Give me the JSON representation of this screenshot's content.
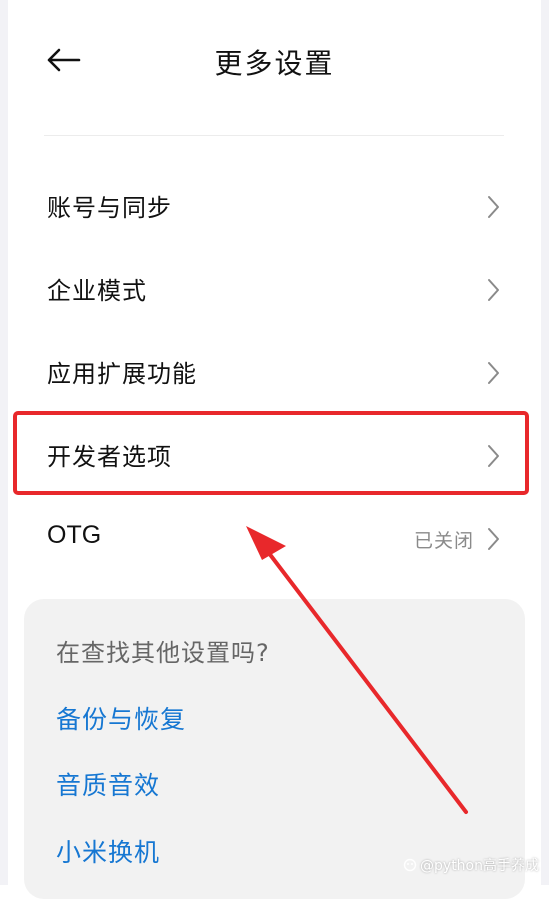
{
  "header": {
    "title": "更多设置",
    "back_icon": "arrow-left-icon"
  },
  "settings": {
    "items": [
      {
        "label": "账号与同步",
        "value": ""
      },
      {
        "label": "企业模式",
        "value": ""
      },
      {
        "label": "应用扩展功能",
        "value": ""
      },
      {
        "label": "开发者选项",
        "value": ""
      },
      {
        "label": "OTG",
        "value": "已关闭"
      }
    ],
    "chevron_icon": "chevron-right-icon"
  },
  "suggest": {
    "title": "在查找其他设置吗?",
    "links": [
      "备份与恢复",
      "音质音效",
      "小米换机"
    ],
    "link_color": "#1677d2"
  },
  "annotation": {
    "highlight_color": "#e8282b",
    "highlighted_item": "开发者选项"
  },
  "watermark": {
    "text": "@python高手养成"
  }
}
